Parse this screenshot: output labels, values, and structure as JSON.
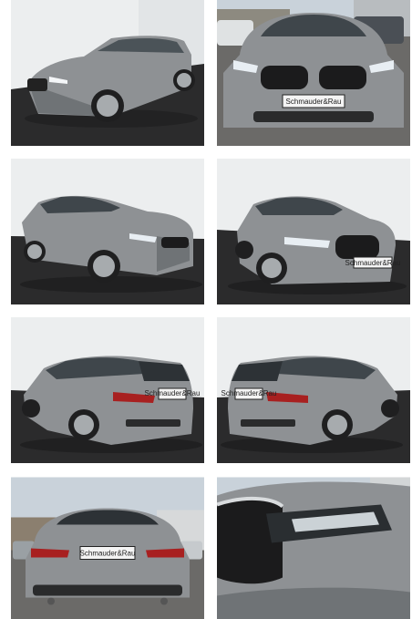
{
  "gallery": {
    "photos": [
      {
        "view": "front-left three-quarter",
        "setting": "studio"
      },
      {
        "view": "front",
        "setting": "outdoor lot",
        "plate": "Schmauder&Rau"
      },
      {
        "view": "front-left profile",
        "setting": "studio"
      },
      {
        "view": "front-right three-quarter",
        "setting": "studio",
        "plate": "Schmauder&Rau"
      },
      {
        "view": "rear-left three-quarter",
        "setting": "studio",
        "plate": "Schmauder&Rau"
      },
      {
        "view": "rear-right three-quarter",
        "setting": "studio",
        "plate": "Schmauder&Rau"
      },
      {
        "view": "rear",
        "setting": "outdoor lot",
        "plate": "Schmauder&Rau"
      },
      {
        "view": "headlight close-up",
        "setting": "outdoor lot"
      }
    ]
  },
  "colors": {
    "car_body": "#8e9194",
    "studio_wall": "#eceeef",
    "studio_floor": "#2b2b2c",
    "sky": "#c9d2da",
    "asphalt": "#6b6a68"
  }
}
